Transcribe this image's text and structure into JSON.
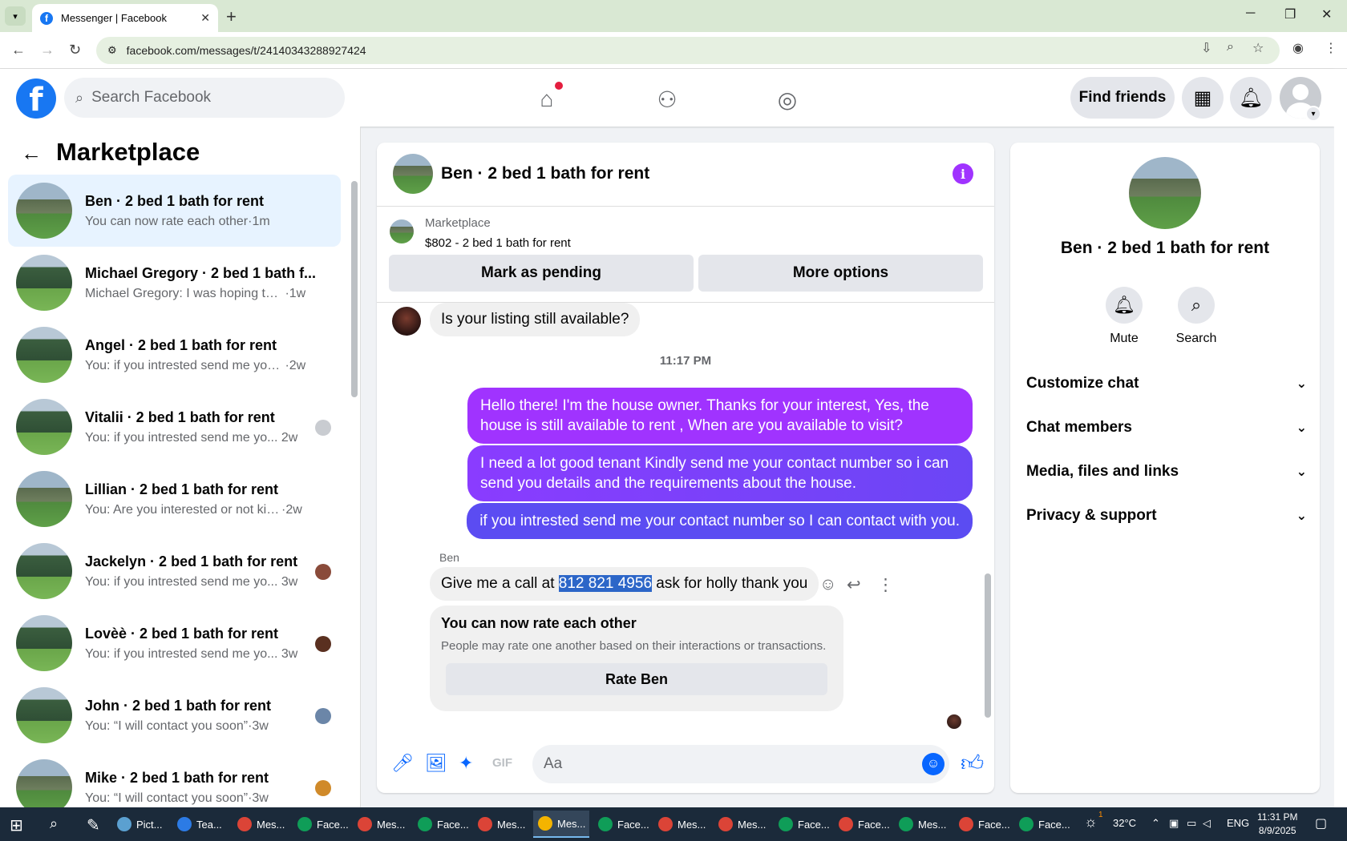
{
  "browser": {
    "tab_title": "Messenger | Facebook",
    "url": "facebook.com/messages/t/24140343288927424",
    "new_tab": "+",
    "minimize": "─",
    "restore": "❐",
    "close": "✕"
  },
  "header": {
    "search_placeholder": "Search Facebook",
    "find_friends": "Find friends"
  },
  "sidebar": {
    "title": "Marketplace",
    "conversations": [
      {
        "name": "Ben · 2 bed 1 bath for rent",
        "preview": "You can now rate each other",
        "time": "·1m",
        "active": true
      },
      {
        "name": "Michael Gregory · 2 bed 1 bath f...",
        "preview": "Michael Gregory: I was hoping to h...",
        "time": "·1w"
      },
      {
        "name": "Angel · 2 bed 1 bath for rent",
        "preview": "You: if you intrested send me your ...",
        "time": "·2w"
      },
      {
        "name": "Vitalii · 2 bed 1 bath for rent",
        "preview": "You: if you intrested send me yo...",
        "time": "2w"
      },
      {
        "name": "Lillian · 2 bed 1 bath for rent",
        "preview": "You: Are you interested or not kindl...",
        "time": "·2w"
      },
      {
        "name": "Jackelyn · 2 bed 1 bath for rent",
        "preview": "You: if you intrested send me yo...",
        "time": "3w"
      },
      {
        "name": "Lovèè · 2 bed 1 bath for rent",
        "preview": "You: if you intrested send me yo...",
        "time": "3w"
      },
      {
        "name": "John · 2 bed 1 bath for rent",
        "preview": "You: “I will contact you soon”",
        "time": "·3w"
      },
      {
        "name": "Mike · 2 bed 1 bath for rent",
        "preview": "You: “I will contact you soon”",
        "time": "·3w"
      }
    ]
  },
  "chat": {
    "title": "Ben · 2 bed 1 bath for rent",
    "listing_source": "Marketplace",
    "listing_price": "$802 - 2 bed 1 bath for rent",
    "mark_pending": "Mark as pending",
    "more_options": "More options",
    "msg_question": "Is your listing still available?",
    "timestamp": "11:17 PM",
    "out_1": "Hello there! I'm the house owner. Thanks for your interest, Yes, the house is still available to rent , When are you available to visit?",
    "out_2": "I need a lot good tenant Kindly send me your contact number so i can send you details and the requirements about the house.",
    "out_3": "if you intrested send me your contact number so I can contact with you.",
    "sender": "Ben",
    "in_pre": "Give me a call at ",
    "in_phone": "812 821 4956",
    "in_post": " ask for holly thank you",
    "rate_title": "You can now rate each other",
    "rate_sub": "People may rate one another based on their interactions or transactions.",
    "rate_button": "Rate Ben",
    "composer_placeholder": "Aa"
  },
  "right_panel": {
    "name": "Ben · 2 bed 1 bath for rent",
    "mute": "Mute",
    "search": "Search",
    "sections": [
      "Customize chat",
      "Chat members",
      "Media, files and links",
      "Privacy & support"
    ]
  },
  "taskbar": {
    "items": [
      "Pict...",
      "Tea...",
      "Mes...",
      "Face...",
      "Mes...",
      "Face...",
      "Mes...",
      "Mes...",
      "Face...",
      "Mes...",
      "Mes...",
      "Face...",
      "Face...",
      "Mes...",
      "Face...",
      "Face..."
    ],
    "weather": "32°C",
    "weather_badge": "1",
    "lang": "ENG",
    "time": "11:31 PM",
    "date": "8/9/2025"
  },
  "colors": {
    "fb_blue": "#1877f2",
    "messenger_purple": "#a033ff",
    "active_conv": "#e7f3ff"
  }
}
